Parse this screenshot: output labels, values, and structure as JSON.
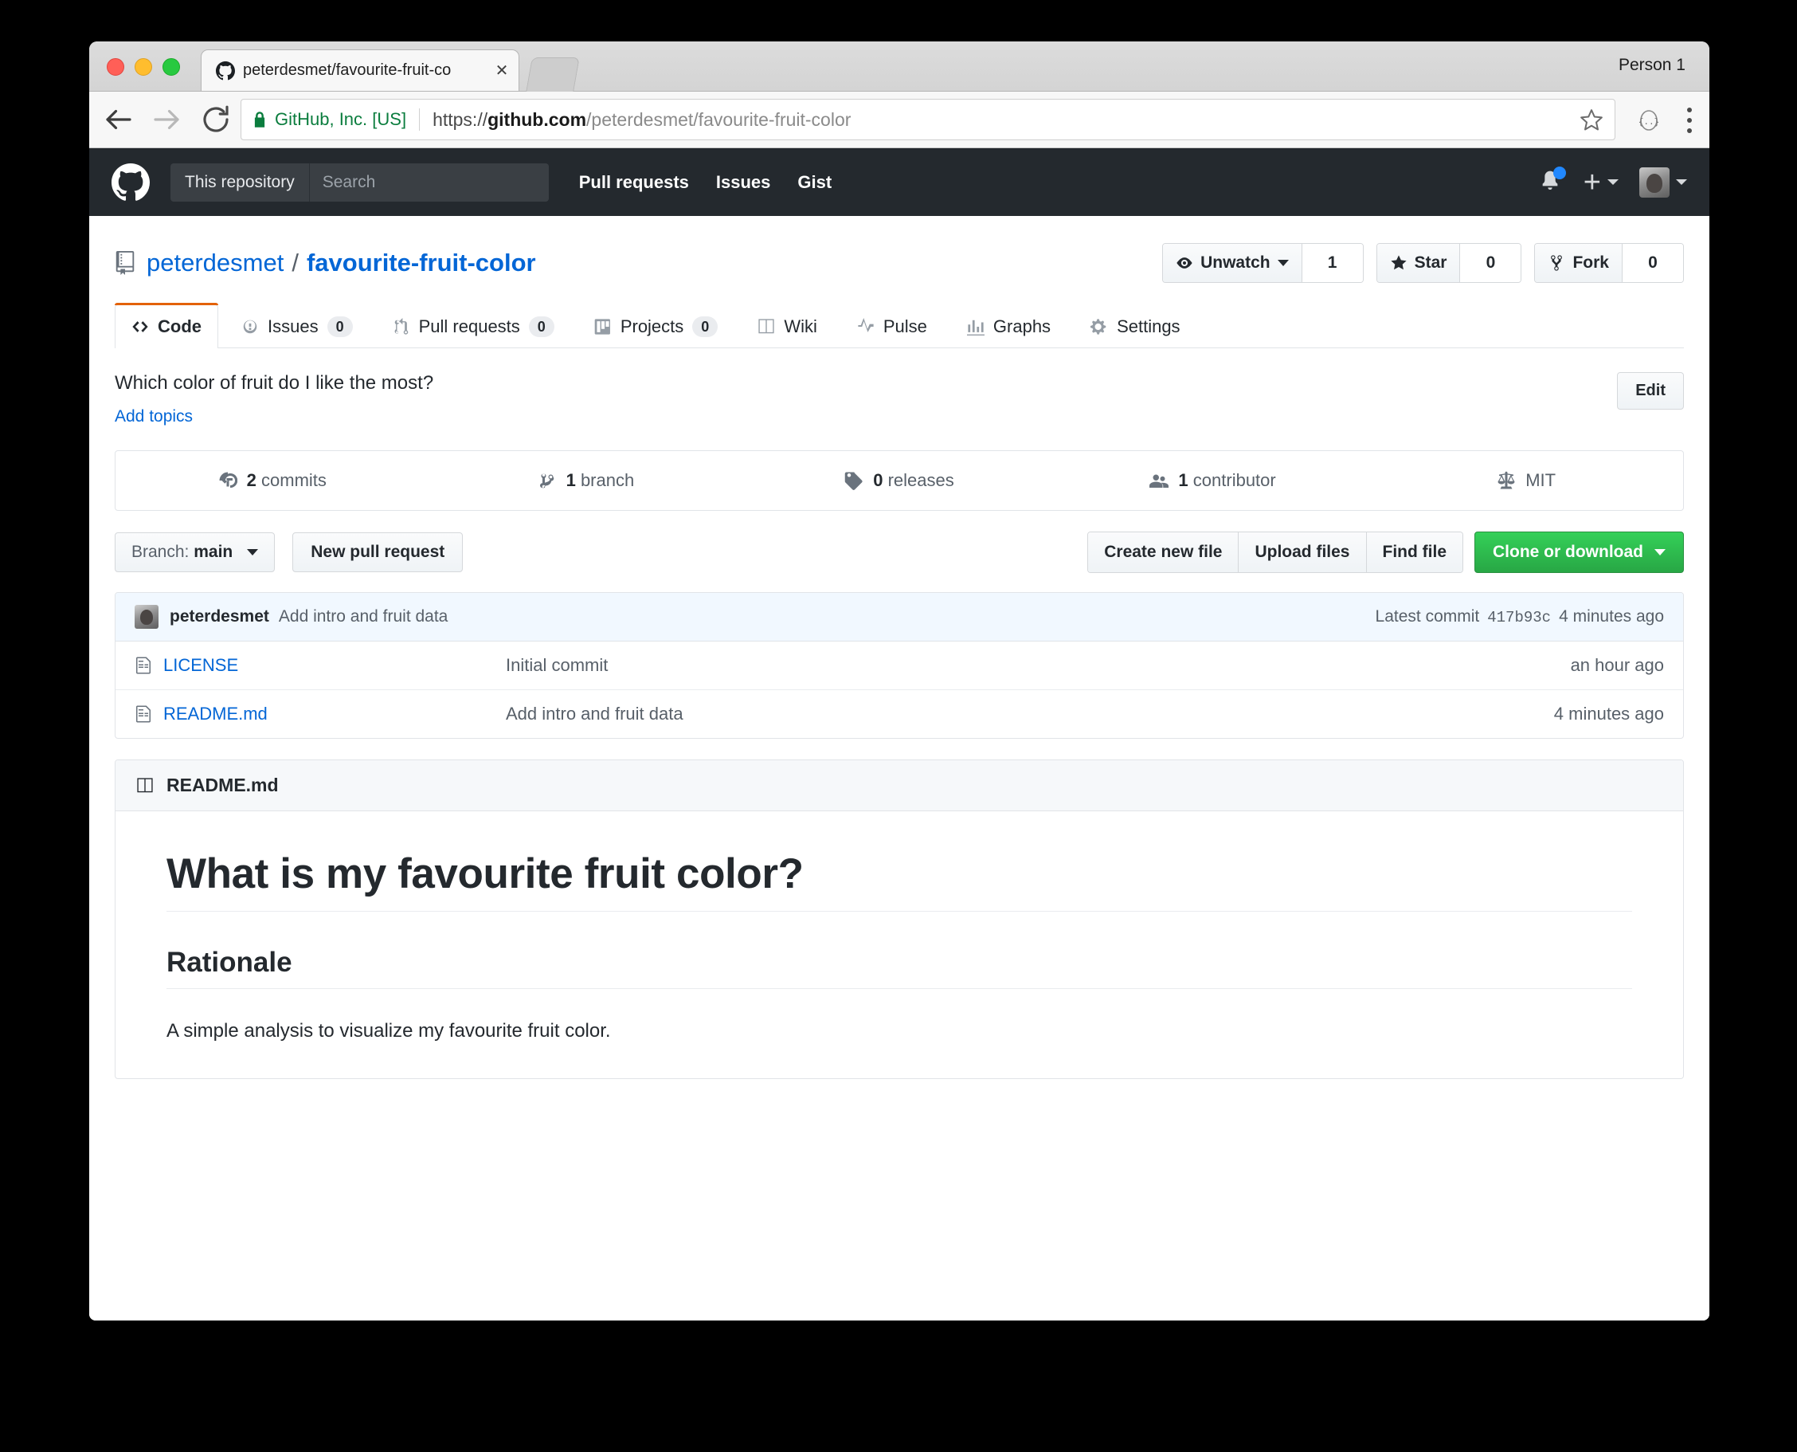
{
  "browser": {
    "profile_name": "Person 1",
    "tab_title": "peterdesmet/favourite-fruit-co",
    "tab_close_label": "✕",
    "security_label": "GitHub, Inc. [US]",
    "url_scheme": "https://",
    "url_host": "github.com",
    "url_path": "/peterdesmet/favourite-fruit-color"
  },
  "gh_header": {
    "search_scope": "This repository",
    "search_placeholder": "Search",
    "nav": [
      {
        "label": "Pull requests"
      },
      {
        "label": "Issues"
      },
      {
        "label": "Gist"
      }
    ]
  },
  "repo": {
    "owner": "peterdesmet",
    "separator": "/",
    "name": "favourite-fruit-color",
    "description": "Which color of fruit do I like the most?",
    "add_topics_label": "Add topics",
    "edit_label": "Edit",
    "actions": [
      {
        "label": "Unwatch",
        "count": "1",
        "icon": "eye-icon",
        "has_caret": true
      },
      {
        "label": "Star",
        "count": "0",
        "icon": "star-icon",
        "has_caret": false
      },
      {
        "label": "Fork",
        "count": "0",
        "icon": "fork-icon",
        "has_caret": false
      }
    ]
  },
  "tabs": [
    {
      "label": "Code",
      "badge": "",
      "icon": "code-icon",
      "active": true
    },
    {
      "label": "Issues",
      "badge": "0",
      "icon": "issue-opened-icon",
      "active": false
    },
    {
      "label": "Pull requests",
      "badge": "0",
      "icon": "git-pull-request-icon",
      "active": false
    },
    {
      "label": "Projects",
      "badge": "0",
      "icon": "project-icon",
      "active": false
    },
    {
      "label": "Wiki",
      "badge": "",
      "icon": "book-icon",
      "active": false
    },
    {
      "label": "Pulse",
      "badge": "",
      "icon": "pulse-icon",
      "active": false
    },
    {
      "label": "Graphs",
      "badge": "",
      "icon": "graph-icon",
      "active": false
    },
    {
      "label": "Settings",
      "badge": "",
      "icon": "gear-icon",
      "active": false
    }
  ],
  "stats": [
    {
      "value": "2",
      "label": "commits",
      "icon": "history-icon"
    },
    {
      "value": "1",
      "label": "branch",
      "icon": "branch-icon"
    },
    {
      "value": "0",
      "label": "releases",
      "icon": "tag-icon"
    },
    {
      "value": "1",
      "label": "contributor",
      "icon": "people-icon"
    },
    {
      "value": "",
      "label": "MIT",
      "icon": "law-icon"
    }
  ],
  "branch_row": {
    "branch_prefix": "Branch:",
    "branch_name": "main",
    "new_pull_request": "New pull request",
    "file_buttons": [
      "Create new file",
      "Upload files",
      "Find file"
    ],
    "clone_label": "Clone or download"
  },
  "commit_bar": {
    "author": "peterdesmet",
    "message": "Add intro and fruit data",
    "latest_label": "Latest commit",
    "sha": "417b93c",
    "time": "4 minutes ago"
  },
  "files": [
    {
      "name": "LICENSE",
      "message": "Initial commit",
      "time": "an hour ago"
    },
    {
      "name": "README.md",
      "message": "Add intro and fruit data",
      "time": "4 minutes ago"
    }
  ],
  "readme": {
    "header": "README.md",
    "h1": "What is my favourite fruit color?",
    "h2": "Rationale",
    "paragraph": "A simple analysis to visualize my favourite fruit color."
  },
  "colors": {
    "gh_header_bg": "#24292e",
    "link_blue": "#0366d6",
    "green_btn": "#28a745",
    "tab_accent_orange": "#e36209",
    "secure_green": "#0b7d3e",
    "commit_bar_blue": "#f1f8ff"
  }
}
